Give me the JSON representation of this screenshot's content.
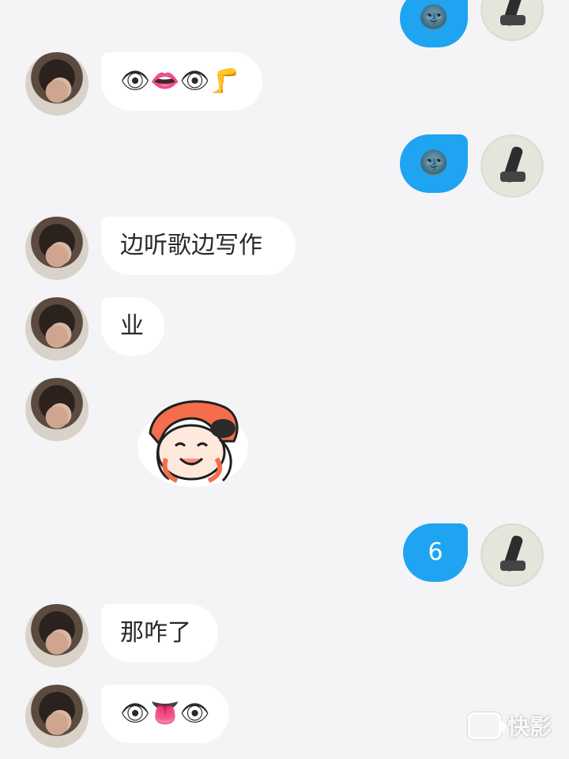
{
  "messages": [
    {
      "side": "right",
      "text": "🌚"
    },
    {
      "side": "left",
      "text": "👁👄👁🦵"
    },
    {
      "side": "right",
      "text": "🌚"
    },
    {
      "side": "left",
      "text": "边听歌边写作"
    },
    {
      "side": "left",
      "text": "业"
    },
    {
      "side": "left",
      "sticker": "cartoon-girl-sticker"
    },
    {
      "side": "right",
      "text": "6"
    },
    {
      "side": "left",
      "text": "那咋了"
    },
    {
      "side": "left",
      "text": "👁👅👁"
    }
  ],
  "watermark": {
    "text": "快影",
    "icon": "video-camera-icon"
  },
  "colors": {
    "background": "#f4f4f6",
    "incoming_bubble": "#ffffff",
    "outgoing_bubble": "#1fa4f2"
  }
}
